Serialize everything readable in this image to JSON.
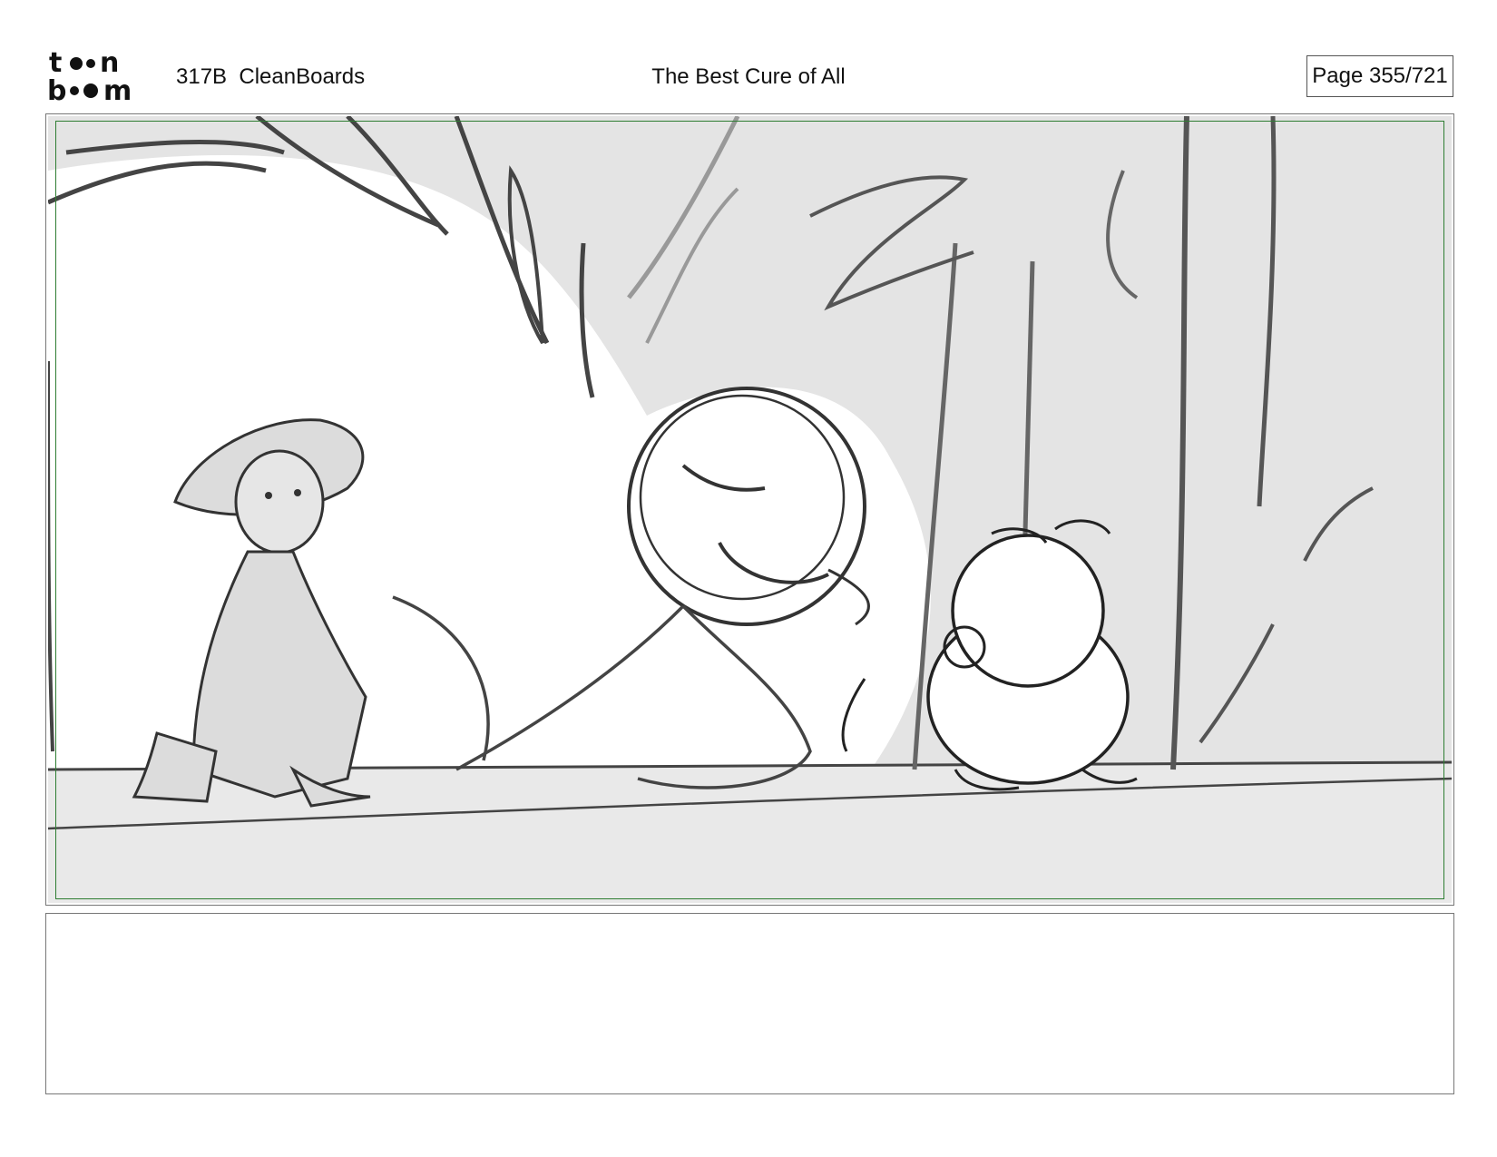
{
  "header": {
    "logo_text": "toon boom",
    "episode_id": "317B  CleanBoards",
    "title": "The Best Cure of All",
    "page_label": "Page 355/721"
  },
  "panel": {
    "description_visible": false,
    "safe_area_color": "#2e7d32",
    "background_fill": "#e4e4e4"
  },
  "notes": {
    "text": ""
  }
}
